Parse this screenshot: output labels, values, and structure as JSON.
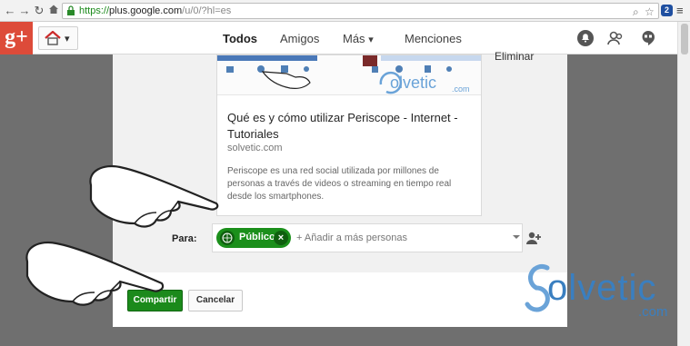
{
  "browser": {
    "url_protocol": "https://",
    "url_host": "plus.google.com",
    "url_path": "/u/0/?hl=es",
    "ext_label": "2"
  },
  "header": {
    "logo": "g+",
    "tabs": [
      {
        "label": "Todos",
        "active": true
      },
      {
        "label": "Amigos"
      },
      {
        "label": "Más"
      },
      {
        "label": "Menciones"
      }
    ]
  },
  "dialog": {
    "side_text": "Eliminar",
    "link_card": {
      "title": "Qué es y cómo utilizar Periscope - Internet - Tutoriales",
      "domain": "solvetic.com",
      "description": "Periscope es una red social utilizada por millones de personas a través de videos o streaming en tiempo real desde los smartphones.",
      "thumb_brand": "olvetic",
      "thumb_brand_suffix": ".com"
    },
    "share": {
      "label": "Para:",
      "chip_label": "Público",
      "placeholder": "+ Añadir a más personas"
    },
    "buttons": {
      "share": "Compartir",
      "cancel": "Cancelar"
    }
  },
  "watermark": {
    "brand": "olvetic",
    "suffix": ".com"
  },
  "colors": {
    "gplus_red": "#dd4b39",
    "share_green": "#1b8a1b",
    "watermark_blue": "#3a7fc0"
  }
}
